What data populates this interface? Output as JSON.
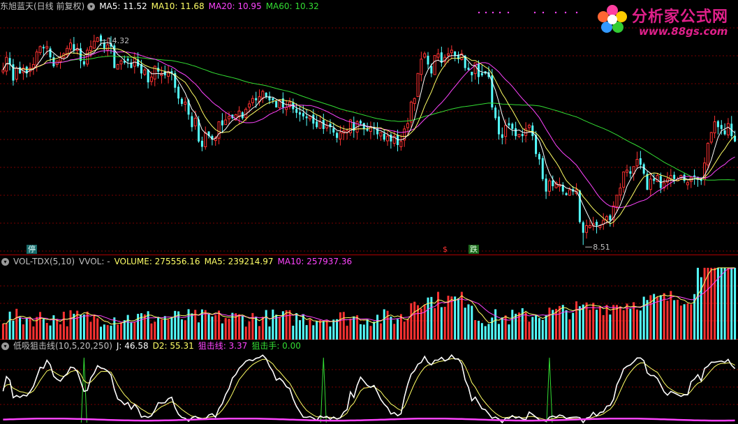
{
  "header": {
    "stock_name": "东旭蓝天(日线 前复权)",
    "ma5_label": "MA5: 11.52",
    "ma10_label": "MA10: 11.68",
    "ma20_label": "MA20: 10.95",
    "ma60_label": "MA60: 10.32"
  },
  "volume_header": {
    "indicator": "VOL-TDX(5,10)",
    "vvol": "VVOL: -",
    "volume": "VOLUME: 275556.16",
    "ma5": "MA5: 239214.97",
    "ma10": "MA10: 257937.36"
  },
  "osc_header": {
    "indicator": "低吸狙击线(10,5,20,250)",
    "j": "J: 46.58",
    "d2": "D2: 55.31",
    "sniper_line": "狙击线: 3.37",
    "sniper": "狙击手: 0.00"
  },
  "logo": {
    "title": "分析家公式网",
    "url": "www.88gs.com"
  },
  "markers": {
    "stop": "停",
    "s": "$",
    "drop": "跌"
  },
  "colors": {
    "up": "#ff3232",
    "down": "#54ffff",
    "ma5": "#ffffff",
    "ma10": "#ffff66",
    "ma20": "#ff44ff",
    "ma60": "#33dd33",
    "grid": "#7a0000",
    "text": "#c0c0c0"
  },
  "chart_data": [
    {
      "type": "candlestick",
      "title": "东旭蓝天(日线 前复权)",
      "annotations": [
        {
          "label": "14.32",
          "value": 14.32
        },
        {
          "label": "8.51",
          "value": 8.51
        }
      ],
      "ylim": [
        8.3,
        15.0
      ],
      "series": [
        {
          "name": "MA5",
          "last": 11.52
        },
        {
          "name": "MA10",
          "last": 11.68
        },
        {
          "name": "MA20",
          "last": 10.95
        },
        {
          "name": "MA60",
          "last": 10.32
        }
      ],
      "close": [
        13.4,
        13.75,
        13.55,
        13.1,
        13.45,
        13.3,
        13.45,
        13.3,
        13.45,
        13.55,
        13.9,
        14.05,
        14.0,
        14.05,
        13.75,
        13.5,
        13.65,
        13.75,
        13.85,
        14.0,
        14.15,
        13.95,
        14.0,
        13.65,
        13.55,
        13.95,
        14.05,
        14.2,
        14.3,
        14.2,
        14.0,
        14.1,
        14.05,
        13.45,
        13.55,
        13.65,
        13.6,
        13.65,
        13.45,
        13.75,
        13.5,
        13.3,
        13.4,
        13.05,
        13.2,
        13.5,
        13.35,
        13.3,
        13.25,
        13.35,
        13.3,
        12.9,
        12.6,
        12.45,
        12.5,
        12.15,
        11.8,
        12.05,
        11.4,
        11.25,
        11.65,
        11.55,
        11.45,
        11.5,
        11.95,
        11.85,
        12.0,
        12.1,
        12.05,
        12.15,
        12.25,
        12.05,
        12.3,
        12.45,
        12.6,
        12.55,
        12.65,
        12.8,
        12.65,
        12.55,
        12.55,
        12.35,
        12.55,
        12.35,
        12.35,
        12.5,
        12.3,
        12.2,
        12.15,
        12.1,
        12.05,
        12.1,
        11.9,
        11.8,
        11.95,
        11.75,
        11.85,
        11.8,
        11.65,
        11.5,
        11.65,
        11.7,
        11.7,
        12.0,
        11.7,
        11.95,
        11.9,
        11.75,
        11.7,
        11.8,
        11.75,
        11.6,
        11.65,
        11.45,
        11.55,
        11.4,
        11.55,
        11.3,
        11.4,
        11.75,
        11.9,
        12.5,
        12.6,
        13.3,
        13.7,
        13.85,
        13.55,
        13.3,
        13.8,
        13.85,
        13.6,
        13.75,
        13.85,
        13.95,
        13.8,
        13.7,
        13.85,
        13.45,
        13.4,
        13.25,
        13.6,
        13.2,
        13.25,
        13.3,
        13.2,
        12.35,
        12.05,
        11.6,
        11.5,
        11.85,
        11.85,
        11.75,
        11.55,
        11.6,
        11.55,
        11.75,
        11.85,
        11.55,
        11.05,
        10.9,
        10.35,
        10.0,
        10.3,
        10.15,
        10.25,
        10.2,
        10.0,
        9.9,
        10.05,
        10.0,
        10.05,
        9.15,
        8.85,
        9.05,
        9.05,
        9.1,
        9.05,
        9.05,
        9.2,
        9.3,
        9.2,
        9.6,
        9.9,
        10.1,
        10.55,
        10.6,
        10.5,
        10.7,
        10.9,
        10.75,
        10.5,
        10.05,
        10.35,
        10.3,
        10.45,
        10.1,
        10.25,
        10.35,
        10.45,
        10.35,
        10.35,
        10.45,
        10.3,
        10.25,
        10.4,
        10.4,
        10.35,
        10.3,
        10.8,
        11.35,
        11.65,
        11.95,
        11.8,
        11.75,
        11.6,
        11.9,
        11.55,
        11.4
      ],
      "volume_panel": {
        "name": "VOLUME",
        "last": 275556.16,
        "ma5": 239214.97,
        "ma10": 257937.36
      },
      "oscillator_panel": {
        "J": 46.58,
        "D2": 55.31,
        "狙击线": 3.37,
        "狙击手": 0.0
      }
    }
  ]
}
